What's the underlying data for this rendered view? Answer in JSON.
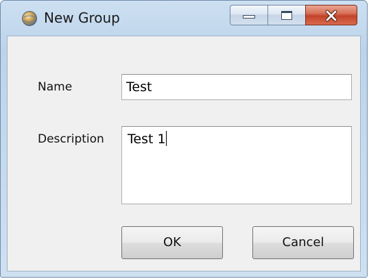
{
  "window": {
    "title": "New Group",
    "icon": "globe-app-icon",
    "caption_buttons": [
      "minimize-icon",
      "maximize-icon",
      "close-icon"
    ],
    "colors": {
      "close_button": "#c3432a",
      "frame": "#bcd3ea"
    }
  },
  "form": {
    "name_label": "Name",
    "name_value": "Test",
    "description_label": "Description",
    "description_value": "Test 1"
  },
  "buttons": {
    "ok_label": "OK",
    "cancel_label": "Cancel"
  }
}
